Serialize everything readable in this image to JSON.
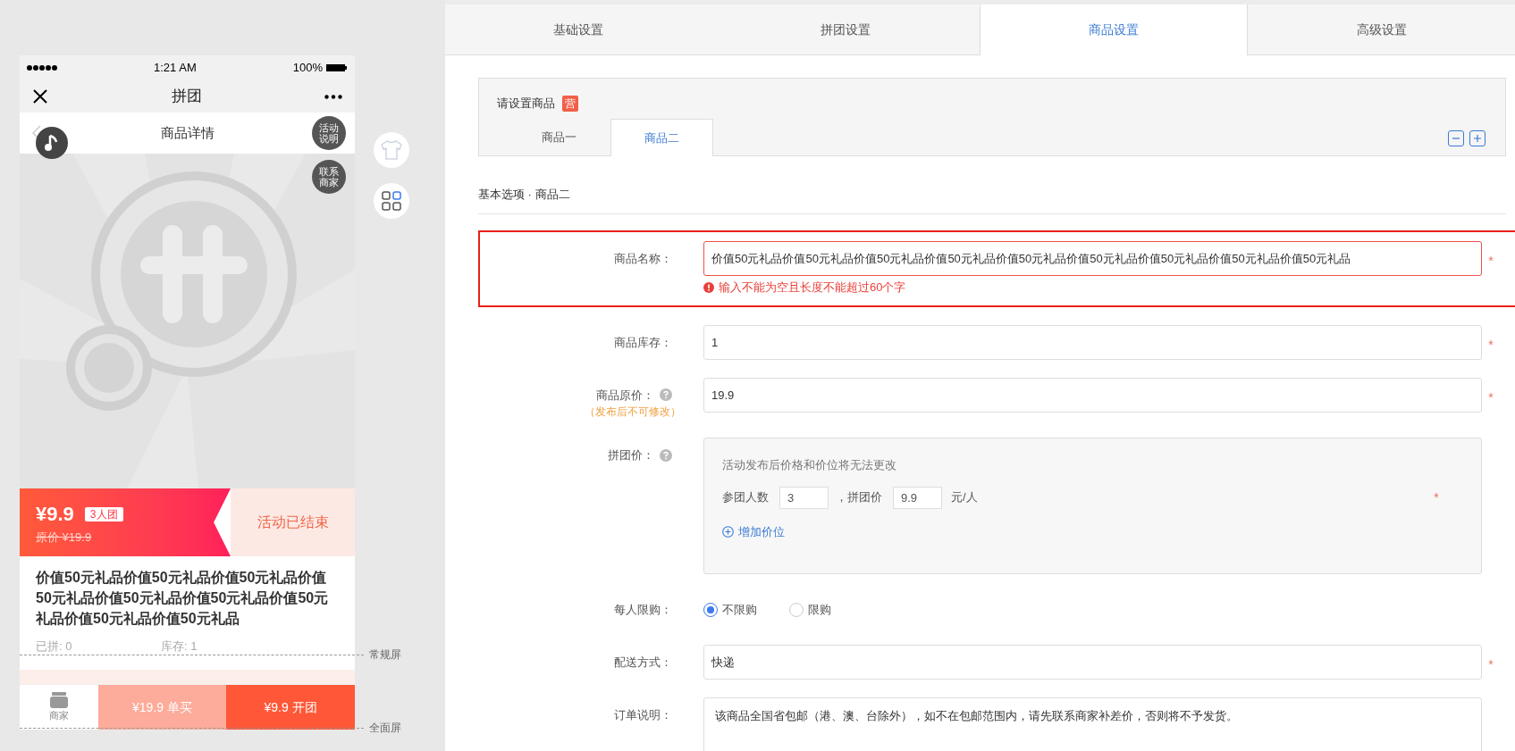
{
  "phone": {
    "status_bar": {
      "time": "1:21 AM",
      "battery": "100%"
    },
    "nav": {
      "title": "拼团"
    },
    "header": {
      "title": "商品详情"
    },
    "float_buttons": [
      "活动说明",
      "联系商家"
    ],
    "price_bar": {
      "price": "¥9.9",
      "group_badge": "3人团",
      "original_price": "原价 ¥19.9",
      "status": "活动已结束"
    },
    "product_title": "价值50元礼品价值50元礼品价值50元礼品价值50元礼品价值50元礼品价值50元礼品价值50元礼品价值50元礼品价值50元礼品",
    "stats": [
      "已拼: 0",
      "库存: 1"
    ],
    "bottom_bar": {
      "shop_label": "商家",
      "buy_single": "¥19.9 单买",
      "buy_group": "¥9.9 开团"
    }
  },
  "screen_markers": [
    "常规屏",
    "全面屏"
  ],
  "tabs": [
    {
      "label": "基础设置",
      "selected": false
    },
    {
      "label": "拼团设置",
      "selected": false
    },
    {
      "label": "商品设置",
      "selected": true
    },
    {
      "label": "高级设置",
      "selected": false
    }
  ],
  "goods_box": {
    "title": "请设置商品",
    "badge": "营",
    "tabs": [
      {
        "label": "商品一",
        "selected": false
      },
      {
        "label": "商品二",
        "selected": true
      }
    ]
  },
  "section_title": "基本选项 · 商品二",
  "form": [
    {
      "kind": "text",
      "label": "商品名称：",
      "value": "价值50元礼品价值50元礼品价值50元礼品价值50元礼品价值50元礼品价值50元礼品价值50元礼品价值50元礼品价值50元礼品",
      "error": "输入不能为空且长度不能超过60个字",
      "required": "*",
      "highlighted": true
    },
    {
      "kind": "text",
      "label": "商品库存：",
      "value": "1",
      "required": "*"
    },
    {
      "kind": "text",
      "label": "商品原价：",
      "help": true,
      "note": "（发布后不可修改）",
      "value": "19.9",
      "required": "*"
    },
    {
      "kind": "tiers",
      "label": "拼团价：",
      "help": true,
      "notice": "活动发布后价格和价位将无法更改",
      "tiers": [
        {
          "people_label": "参团人数",
          "people": "3",
          "price_label": "，拼团价",
          "price": "9.9",
          "unit": "元/人"
        }
      ],
      "add_label": "增加价位",
      "required": "*"
    },
    {
      "kind": "radio",
      "label": "每人限购：",
      "options": [
        {
          "label": "不限购",
          "selected": true
        },
        {
          "label": "限购",
          "selected": false
        }
      ]
    },
    {
      "kind": "text",
      "label": "配送方式：",
      "value": "快递",
      "required": "*"
    },
    {
      "kind": "textarea",
      "label": "订单说明：",
      "value": "该商品全国省包邮（港、澳、台除外），如不在包邮范围内，请先联系商家补差价，否则将不予发货。"
    }
  ]
}
